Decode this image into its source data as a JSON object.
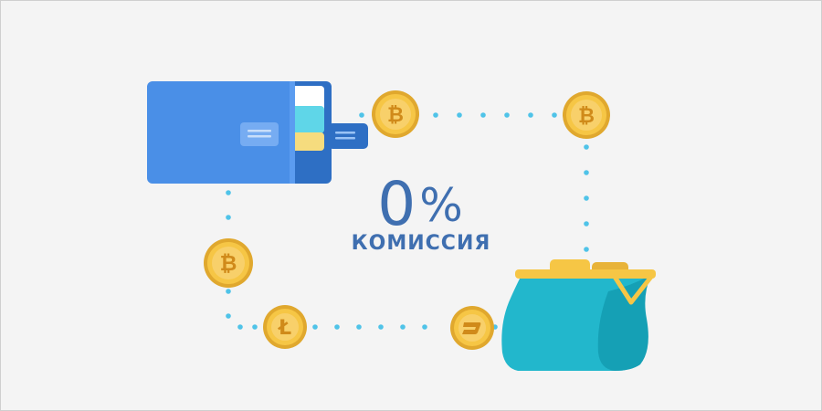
{
  "fee": {
    "value": "0",
    "symbol": "%",
    "label": "КОМИССИЯ"
  },
  "colors": {
    "background": "#f4f4f4",
    "accent_text": "#3f6fb0",
    "dots": "#4fc3e8",
    "wallet": "#4a8fe7",
    "purse": "#22b7cc",
    "coin": "#f6c645"
  },
  "icons": {
    "wallet": "wallet-icon",
    "purse": "purse-icon",
    "coins": [
      "bitcoin-coin-icon",
      "bitcoin-coin-icon",
      "bitcoin-coin-icon",
      "litecoin-coin-icon",
      "dash-coin-icon"
    ]
  }
}
